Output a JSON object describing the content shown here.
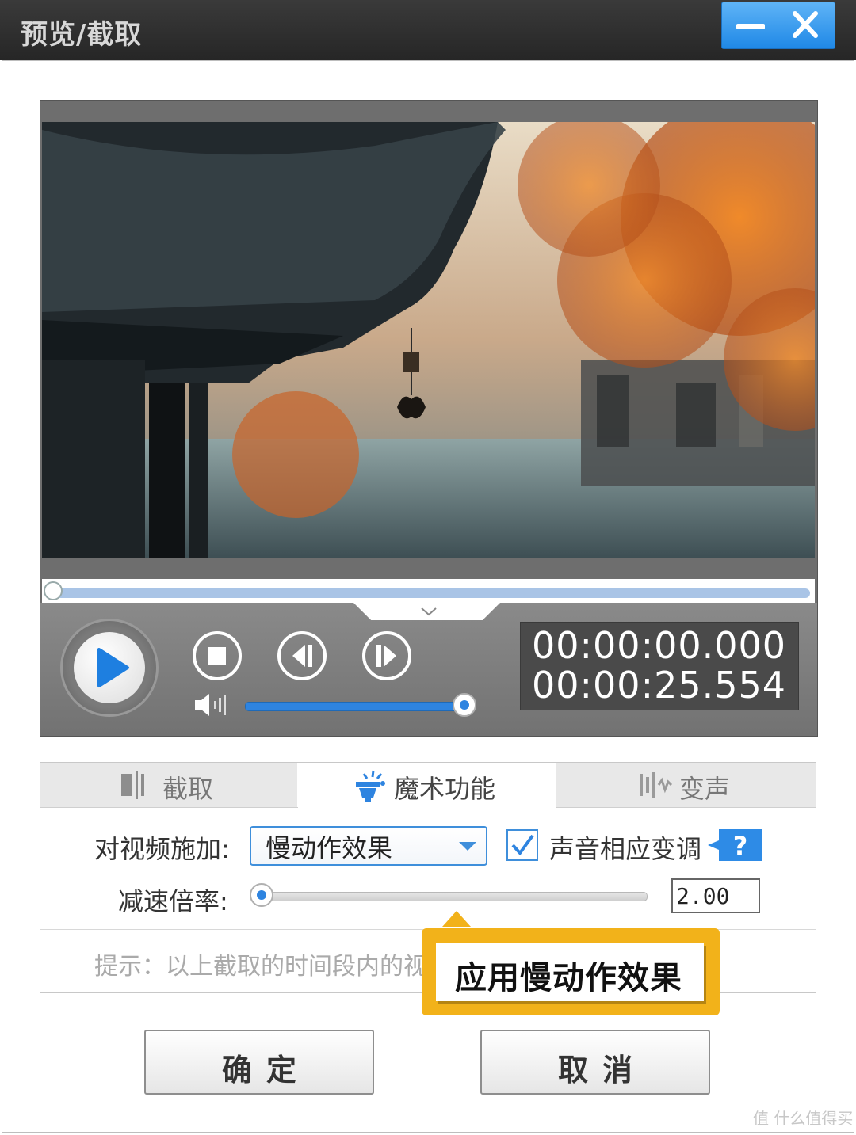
{
  "window": {
    "title": "预览/截取",
    "minimize_icon": "minimize-icon",
    "close_icon": "close-icon",
    "accent_color": "#2b90ea"
  },
  "player": {
    "current_time": "00:00:00.000",
    "total_time": "00:00:25.554",
    "progress_fraction": 0.0,
    "volume_fraction": 1.0,
    "icons": [
      "play-icon",
      "stop-icon",
      "previous-frame-icon",
      "next-frame-icon",
      "volume-icon",
      "chevron-down-icon"
    ]
  },
  "tabs": [
    {
      "label": "截取",
      "icon": "cut-icon",
      "active": false
    },
    {
      "label": "魔术功能",
      "icon": "magic-icon",
      "active": true
    },
    {
      "label": "变声",
      "icon": "waveform-icon",
      "active": false
    }
  ],
  "magic": {
    "apply_label": "对视频施加:",
    "effect_value": "慢动作效果",
    "pitch_checkbox_label": "声音相应变调",
    "pitch_checked": true,
    "help_label": "?",
    "rate_label": "减速倍率:",
    "rate_value": "2.00",
    "hint": "提示：以上截取的时间段内的视"
  },
  "callout": {
    "text": "应用慢动作效果",
    "color": "#f2b21a"
  },
  "buttons": {
    "ok": "确定",
    "cancel": "取消"
  },
  "watermark": "值 什么值得买"
}
